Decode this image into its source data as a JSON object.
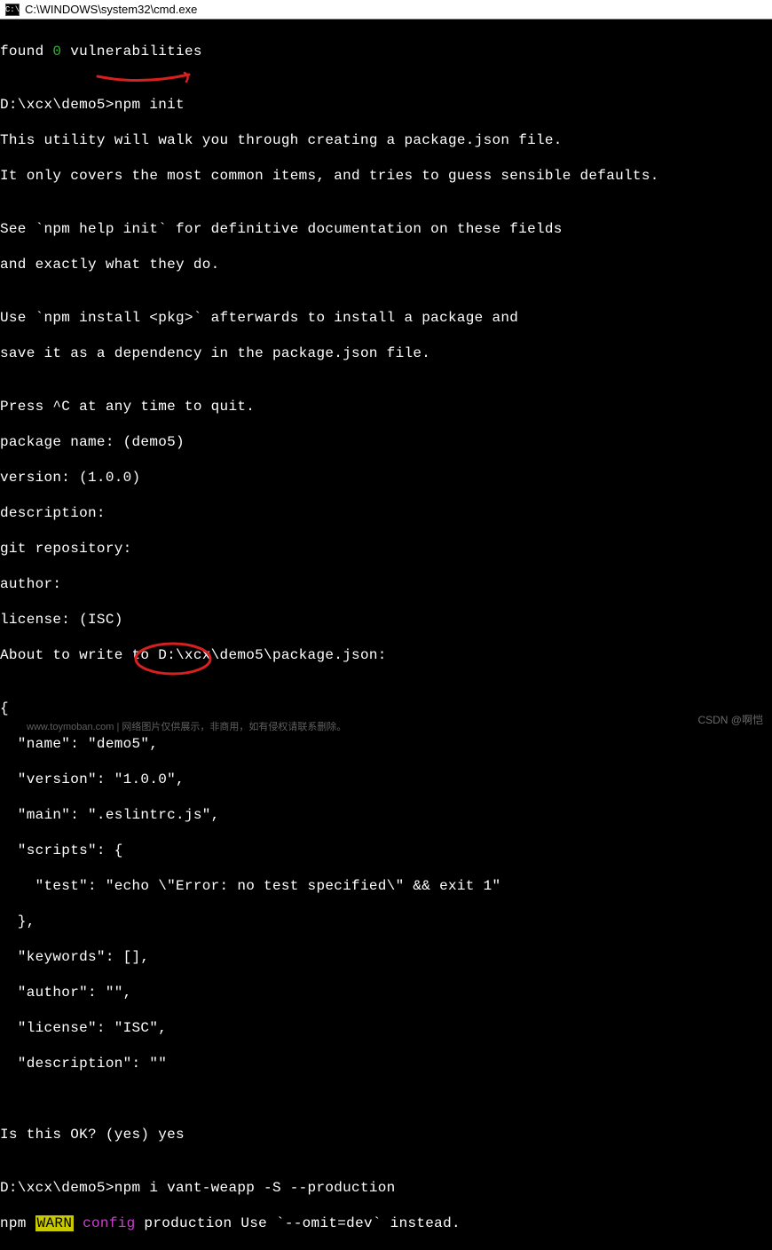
{
  "window": {
    "title": "C:\\WINDOWS\\system32\\cmd.exe",
    "icon_label": "C:\\"
  },
  "terminal": {
    "found_prefix": "found ",
    "vuln_count": "0",
    "found_suffix": " vulnerabilities",
    "blank": "",
    "prompt1_path": "D:\\xcx\\demo5>",
    "prompt1_cmd": "npm init",
    "intro1": "This utility will walk you through creating a package.json file.",
    "intro2": "It only covers the most common items, and tries to guess sensible defaults.",
    "help1": "See `npm help init` for definitive documentation on these fields",
    "help2": "and exactly what they do.",
    "install1": "Use `npm install <pkg>` afterwards to install a package and",
    "install2": "save it as a dependency in the package.json file.",
    "quit": "Press ^C at any time to quit.",
    "pkg_name": "package name: (demo5)",
    "version": "version: (1.0.0)",
    "description": "description:",
    "git_repo": "git repository:",
    "author": "author:",
    "license": "license: (ISC)",
    "about_write": "About to write to D:\\xcx\\demo5\\package.json:",
    "json_open": "{",
    "json_name": "  \"name\": \"demo5\",",
    "json_version": "  \"version\": \"1.0.0\",",
    "json_main": "  \"main\": \".eslintrc.js\",",
    "json_scripts": "  \"scripts\": {",
    "json_test": "    \"test\": \"echo \\\"Error: no test specified\\\" && exit 1\"",
    "json_scripts_close": "  },",
    "json_keywords": "  \"keywords\": [],",
    "json_author": "  \"author\": \"\",",
    "json_license": "  \"license\": \"ISC\",",
    "json_description": "  \"description\": \"\"",
    "is_ok": "Is this OK? (yes) yes",
    "prompt2_full": "D:\\xcx\\demo5>npm i vant-weapp -S --production",
    "warn_prefix": "npm ",
    "warn_tag": "WARN",
    "warn_config": " config",
    "warn_msg": " production Use `--omit=dev` instead."
  },
  "watermark": {
    "csdn": "CSDN @啊恺",
    "bottom": "www.toymoban.com | 网络图片仅供展示，非商用，如有侵权请联系删除。"
  }
}
